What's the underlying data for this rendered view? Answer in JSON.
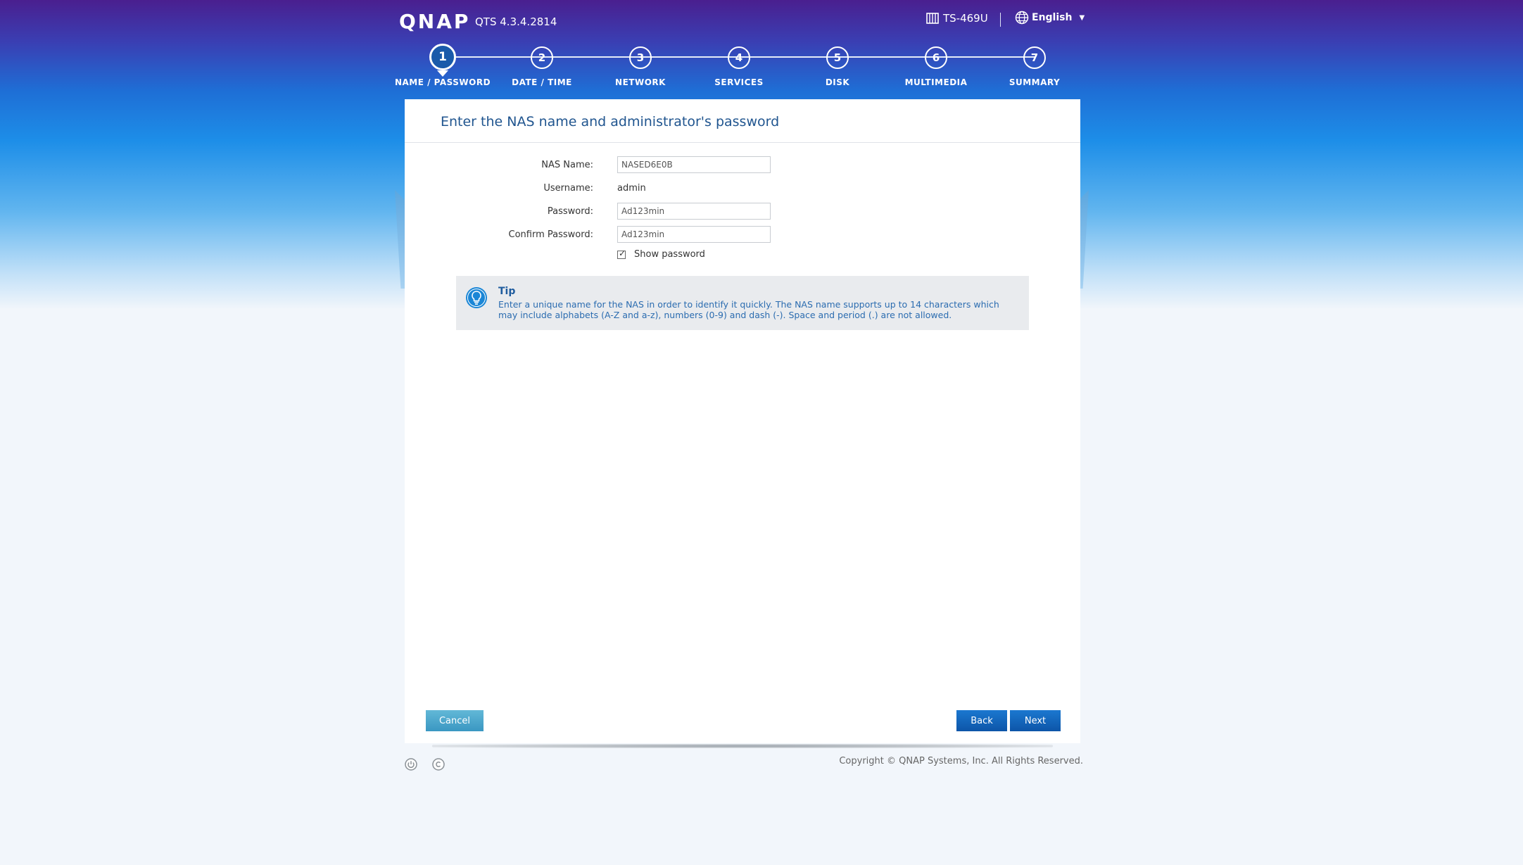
{
  "header": {
    "brand": "QNAP",
    "version": "QTS 4.3.4.2814",
    "model": "TS-469U",
    "language": "English"
  },
  "steps": [
    {
      "num": "1",
      "label": "NAME / PASSWORD"
    },
    {
      "num": "2",
      "label": "DATE / TIME"
    },
    {
      "num": "3",
      "label": "NETWORK"
    },
    {
      "num": "4",
      "label": "SERVICES"
    },
    {
      "num": "5",
      "label": "DISK"
    },
    {
      "num": "6",
      "label": "MULTIMEDIA"
    },
    {
      "num": "7",
      "label": "SUMMARY"
    }
  ],
  "active_step": 1,
  "panel": {
    "title": "Enter the NAS name and administrator's password"
  },
  "form": {
    "nas_name_label": "NAS Name:",
    "nas_name_value": "NASED6E0B",
    "username_label": "Username:",
    "username_value": "admin",
    "password_label": "Password:",
    "password_value": "Ad123min",
    "confirm_label": "Confirm Password:",
    "confirm_value": "Ad123min",
    "show_password_label": "Show password",
    "show_password_checked": true
  },
  "tip": {
    "title": "Tip",
    "text": "Enter a unique name for the NAS in order to identify it quickly. The NAS name supports up to 14 characters which may include alphabets (A-Z and a-z), numbers (0-9) and dash (-). Space and period (.) are not allowed."
  },
  "buttons": {
    "cancel": "Cancel",
    "back": "Back",
    "next": "Next"
  },
  "footer": {
    "copyright": "Copyright © QNAP Systems, Inc. All Rights Reserved."
  },
  "icons": {
    "model": "nas-device-icon",
    "language": "globe-icon",
    "tip": "lightbulb-icon",
    "footer_left": "power-icon",
    "footer_right": "copyright-icon"
  },
  "colors": {
    "primary_button": "#0d55a8",
    "cancel_button": "#3a97c2",
    "title_text": "#20558f"
  }
}
